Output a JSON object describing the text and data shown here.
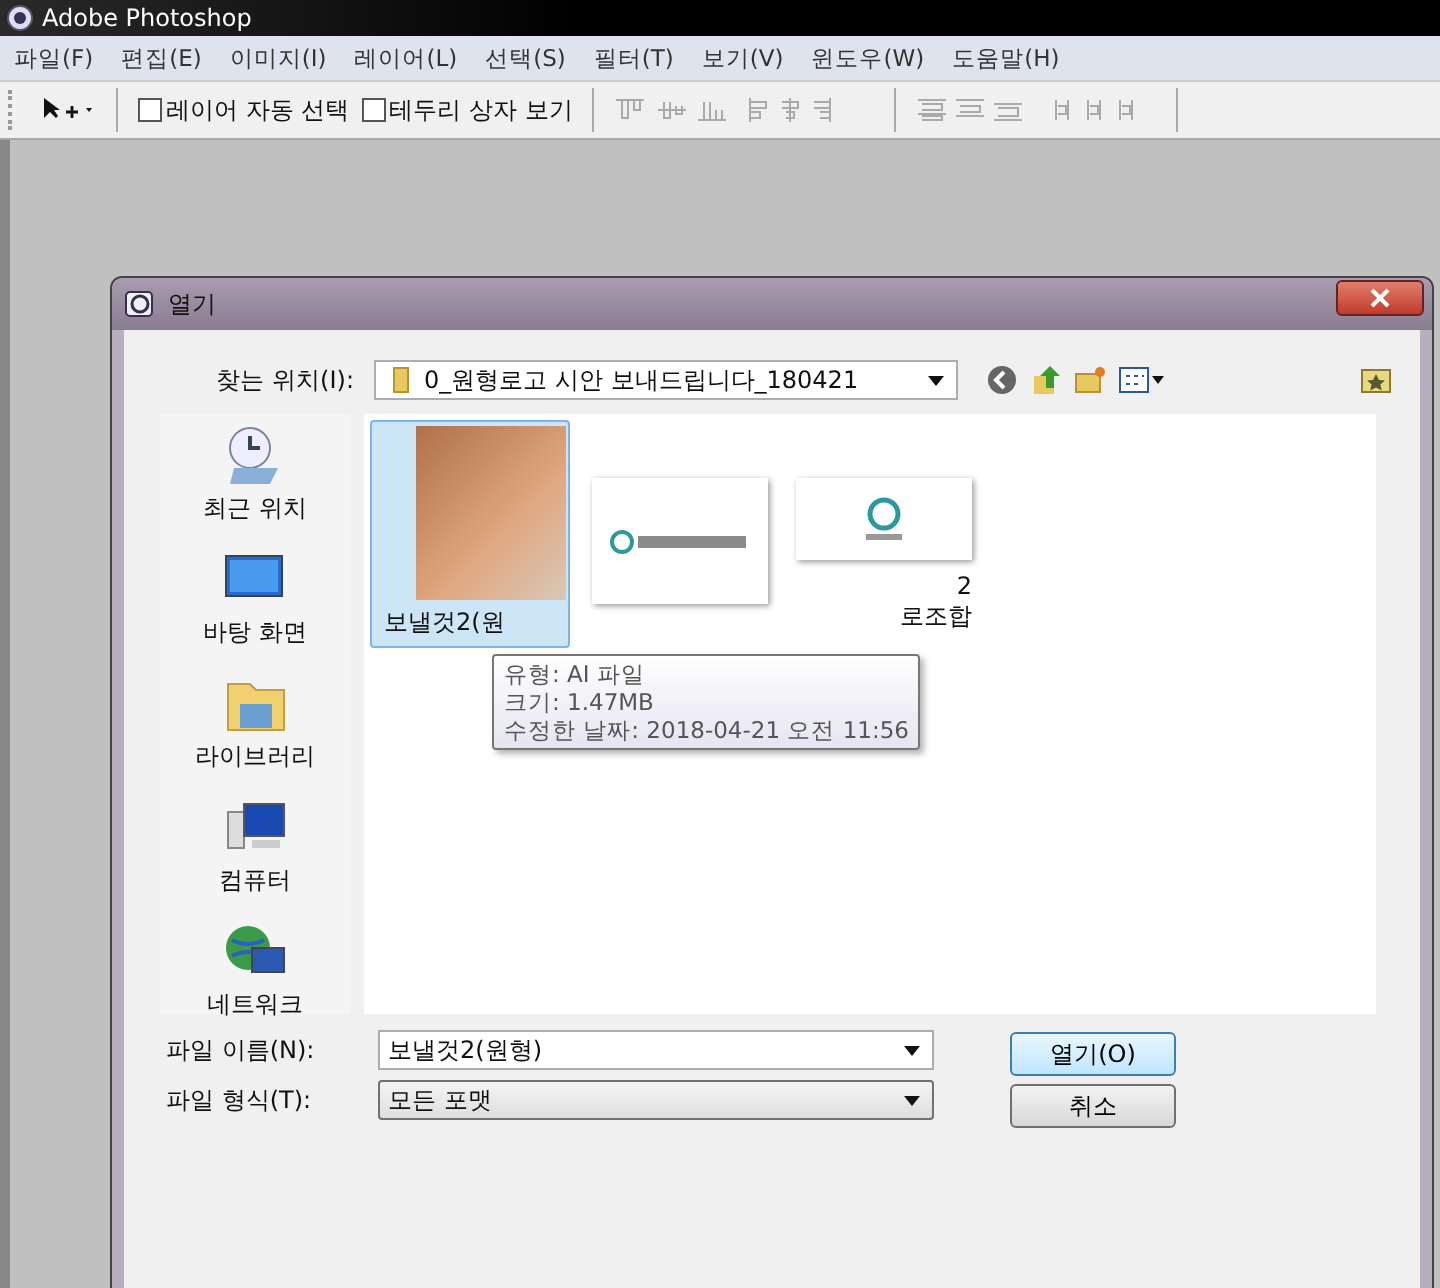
{
  "app": {
    "title": "Adobe Photoshop"
  },
  "menu": [
    "파일(F)",
    "편집(E)",
    "이미지(I)",
    "레이어(L)",
    "선택(S)",
    "필터(T)",
    "보기(V)",
    "윈도우(W)",
    "도움말(H)"
  ],
  "options_bar": {
    "checkboxes": [
      {
        "label": "레이어 자동 선택",
        "checked": false
      },
      {
        "label": "테두리 상자 보기",
        "checked": false
      }
    ]
  },
  "dialog": {
    "title": "열기",
    "look_in": {
      "label": "찾는 위치(I):",
      "value": "0_원형로고 시안 보내드립니다_180421"
    },
    "places": [
      {
        "label": "최근 위치",
        "kind": "recent"
      },
      {
        "label": "바탕 화면",
        "kind": "desktop"
      },
      {
        "label": "라이브러리",
        "kind": "library"
      },
      {
        "label": "컴퓨터",
        "kind": "computer"
      },
      {
        "label": "네트워크",
        "kind": "network"
      }
    ],
    "files": [
      {
        "kind": "photo",
        "label_lines": [
          "보낼것2(원"
        ],
        "selected": true
      },
      {
        "kind": "logo-wide",
        "selected": false
      },
      {
        "kind": "logo-round",
        "label_lines": [
          "2",
          "로조합"
        ],
        "selected": false
      }
    ],
    "tooltip": [
      "유형: AI 파일",
      "크기: 1.47MB",
      "수정한 날짜: 2018-04-21 오전 11:56"
    ],
    "file_name": {
      "label": "파일 이름(N):",
      "value": "보낼것2(원형)"
    },
    "file_type": {
      "label": "파일 형식(T):",
      "value": "모든 포맷"
    },
    "buttons": [
      "열기(O)",
      "취소"
    ]
  }
}
